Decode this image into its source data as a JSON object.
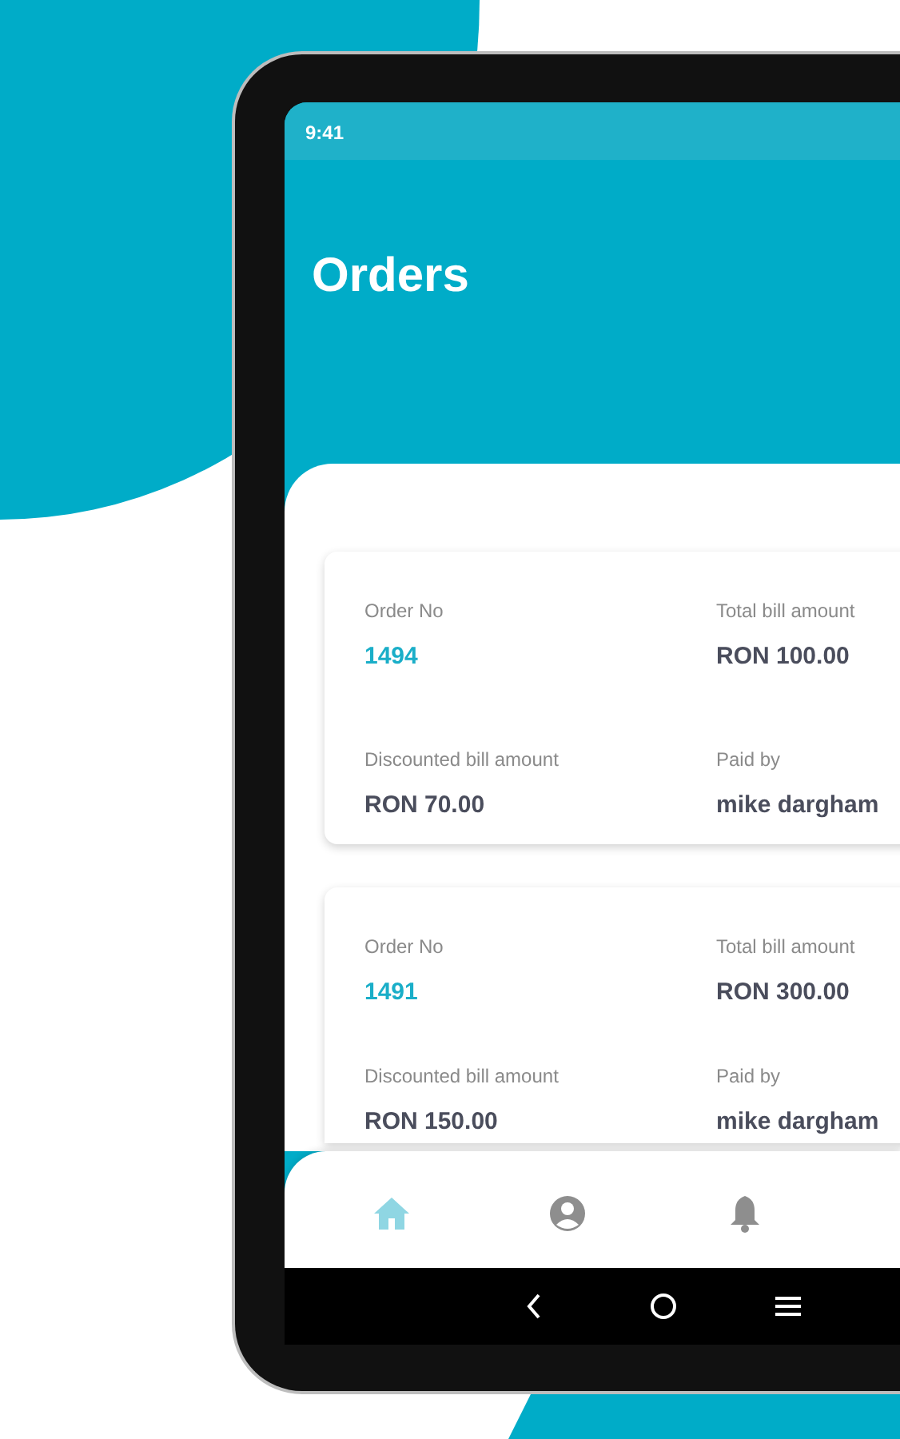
{
  "status_bar": {
    "time": "9:41"
  },
  "header": {
    "title": "Orders"
  },
  "orders": [
    {
      "fields": [
        {
          "label": "Order No",
          "value": "1494",
          "kind": "number"
        },
        {
          "label": "Total bill amount",
          "value": "RON 100.00",
          "kind": "amount"
        },
        {
          "label": "Discounted bill amount",
          "value": "RON 70.00",
          "kind": "amount"
        },
        {
          "label": "Paid by",
          "value": "mike dargham",
          "kind": "amount"
        }
      ]
    },
    {
      "fields": [
        {
          "label": "Order No",
          "value": "1491",
          "kind": "number"
        },
        {
          "label": "Total bill amount",
          "value": "RON 300.00",
          "kind": "amount"
        },
        {
          "label": "Discounted bill amount",
          "value": "RON 150.00",
          "kind": "amount"
        },
        {
          "label": "Paid by",
          "value": "mike dargham",
          "kind": "amount"
        }
      ]
    }
  ],
  "bottom_nav": [
    {
      "kind": "home",
      "selected": true
    },
    {
      "kind": "profile",
      "selected": false
    },
    {
      "kind": "notifications",
      "selected": false
    }
  ]
}
